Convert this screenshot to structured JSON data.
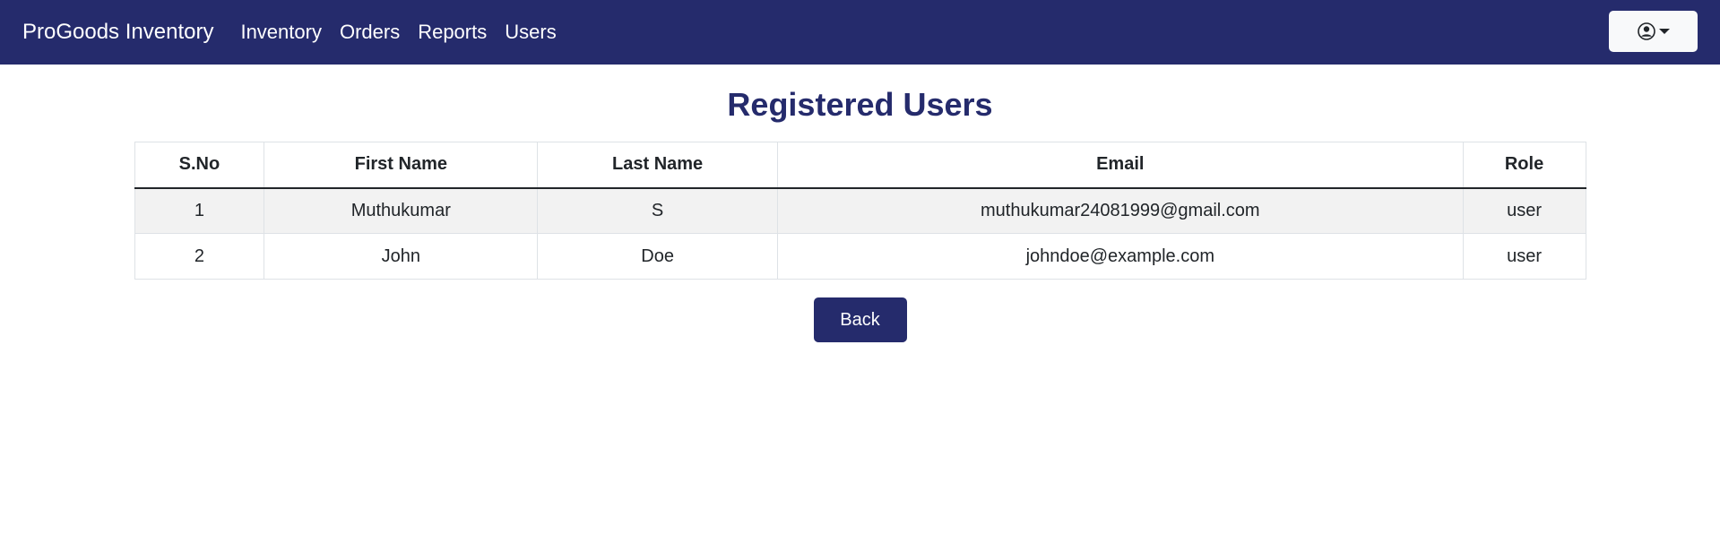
{
  "navbar": {
    "brand": "ProGoods Inventory",
    "links": [
      "Inventory",
      "Orders",
      "Reports",
      "Users"
    ],
    "user_menu_icon": "user-circle-icon"
  },
  "page": {
    "title": "Registered Users"
  },
  "table": {
    "headers": [
      "S.No",
      "First Name",
      "Last Name",
      "Email",
      "Role"
    ],
    "rows": [
      [
        "1",
        "Muthukumar",
        "S",
        "muthukumar24081999@gmail.com",
        "user"
      ],
      [
        "2",
        "John",
        "Doe",
        "johndoe@example.com",
        "user"
      ]
    ]
  },
  "actions": {
    "back_label": "Back"
  },
  "colors": {
    "primary": "#252b6c",
    "striped_row": "#f2f2f2"
  }
}
